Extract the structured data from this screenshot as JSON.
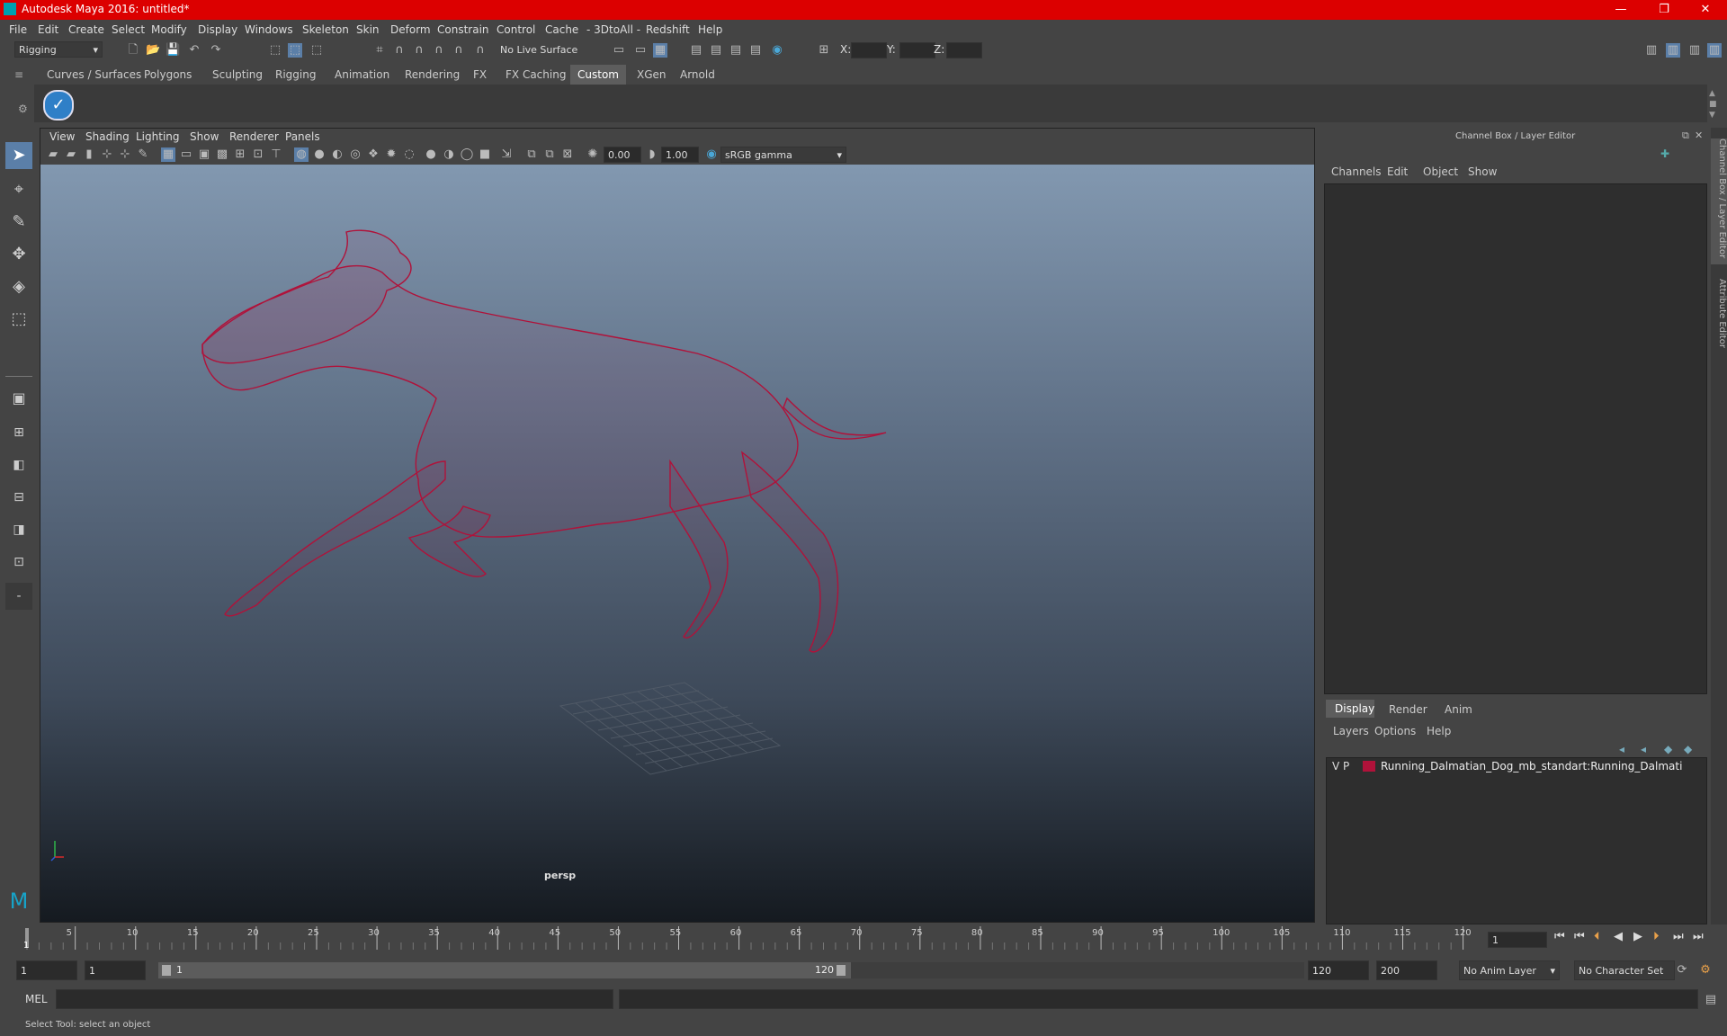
{
  "window": {
    "title": "Autodesk Maya 2016: untitled*",
    "minimize": "—",
    "restore": "❐",
    "close": "✕"
  },
  "menu": [
    "File",
    "Edit",
    "Create",
    "Select",
    "Modify",
    "Display",
    "Windows",
    "Skeleton",
    "Skin",
    "Deform",
    "Constrain",
    "Control",
    "Cache",
    "- 3DtoAll -",
    "Redshift",
    "Help"
  ],
  "toolbar": {
    "mode": "Rigging",
    "live_surface": "No Live Surface",
    "x_label": "X:",
    "y_label": "Y:",
    "z_label": "Z:"
  },
  "shelf": {
    "tabs": [
      "Curves / Surfaces",
      "Polygons",
      "Sculpting",
      "Rigging",
      "Animation",
      "Rendering",
      "FX",
      "FX Caching",
      "Custom",
      "XGen",
      "Arnold"
    ],
    "active": "Custom"
  },
  "viewport": {
    "menus": [
      "View",
      "Shading",
      "Lighting",
      "Show",
      "Renderer",
      "Panels"
    ],
    "exposure": "0.00",
    "gamma": "1.00",
    "color_space": "sRGB gamma",
    "camera_label": "persp",
    "wire_color": "#b0123a"
  },
  "channelbox": {
    "title": "Channel Box / Layer Editor",
    "menus": [
      "Channels",
      "Edit",
      "Object",
      "Show"
    ]
  },
  "layers": {
    "tabs": [
      "Display",
      "Render",
      "Anim"
    ],
    "active_tab": "Display",
    "menus": [
      "Layers",
      "Options",
      "Help"
    ],
    "items": [
      {
        "v": "V",
        "p": "P",
        "color": "#b0123a",
        "name": "Running_Dalmatian_Dog_mb_standart:Running_Dalmati"
      }
    ]
  },
  "side_tabs": [
    "Channel Box / Layer Editor",
    "Attribute Editor"
  ],
  "timeline": {
    "ticks": [
      "5",
      "10",
      "15",
      "20",
      "25",
      "30",
      "35",
      "40",
      "45",
      "50",
      "55",
      "60",
      "65",
      "70",
      "75",
      "80",
      "85",
      "90",
      "95",
      "100",
      "105",
      "110",
      "115",
      "120"
    ],
    "current_frame": "1",
    "current_field": "1"
  },
  "range": {
    "start": "1",
    "start_inner": "1",
    "slider_start": "1",
    "slider_end": "120",
    "end_inner": "120",
    "end": "200",
    "anim_layer": "No Anim Layer",
    "char_set": "No Character Set"
  },
  "cmdline": {
    "label": "MEL"
  },
  "help_line": "Select Tool: select an object"
}
